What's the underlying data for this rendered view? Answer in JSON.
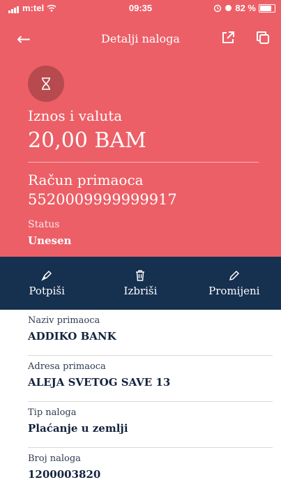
{
  "status_bar": {
    "carrier": "m:tel",
    "time": "09:35",
    "battery": "82 %"
  },
  "nav": {
    "title": "Detalji naloga",
    "back_icon": "arrow-left-icon",
    "share_icon": "external-link-icon",
    "copy_icon": "copy-icon"
  },
  "summary": {
    "status_icon": "hourglass-icon",
    "amount_label": "Iznos i valuta",
    "amount_value": "20,00 BAM",
    "account_label": "Račun primaoca",
    "account_value": "5520009999999917",
    "status_label": "Status",
    "status_value": "Unesen"
  },
  "actions": [
    {
      "label": "Potpiši",
      "icon": "pen-nib-icon"
    },
    {
      "label": "Izbriši",
      "icon": "trash-icon"
    },
    {
      "label": "Promijeni",
      "icon": "pencil-icon"
    }
  ],
  "details": [
    {
      "label": "Naziv primaoca",
      "value": "ADDIKO BANK"
    },
    {
      "label": "Adresa primaoca",
      "value": "ALEJA SVETOG SAVE 13"
    },
    {
      "label": "Tip naloga",
      "value": "Plaćanje u zemlji"
    },
    {
      "label": "Broj naloga",
      "value": "1200003820"
    }
  ],
  "colors": {
    "hero_bg": "#ec5f67",
    "action_bar_bg": "#16304f",
    "status_circle": "#b64a4f"
  }
}
